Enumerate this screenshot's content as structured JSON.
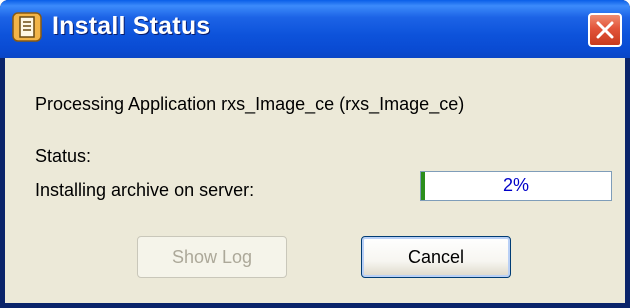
{
  "window": {
    "title": "Install Status"
  },
  "message": {
    "processing": "Processing Application rxs_Image_ce (rxs_Image_ce)"
  },
  "status": {
    "label": "Status:",
    "detail": "Installing archive on server:",
    "progress_text": "2%",
    "progress_fraction": 0.02
  },
  "buttons": {
    "show_log": "Show Log",
    "cancel": "Cancel",
    "show_log_enabled": false
  },
  "icons": {
    "app": "app-document-icon",
    "close": "close-icon"
  },
  "colors": {
    "titlebar": "#0d53db",
    "close_button": "#e2543a",
    "dialog_background": "#ece9d8",
    "progress_text": "#0000c8"
  }
}
